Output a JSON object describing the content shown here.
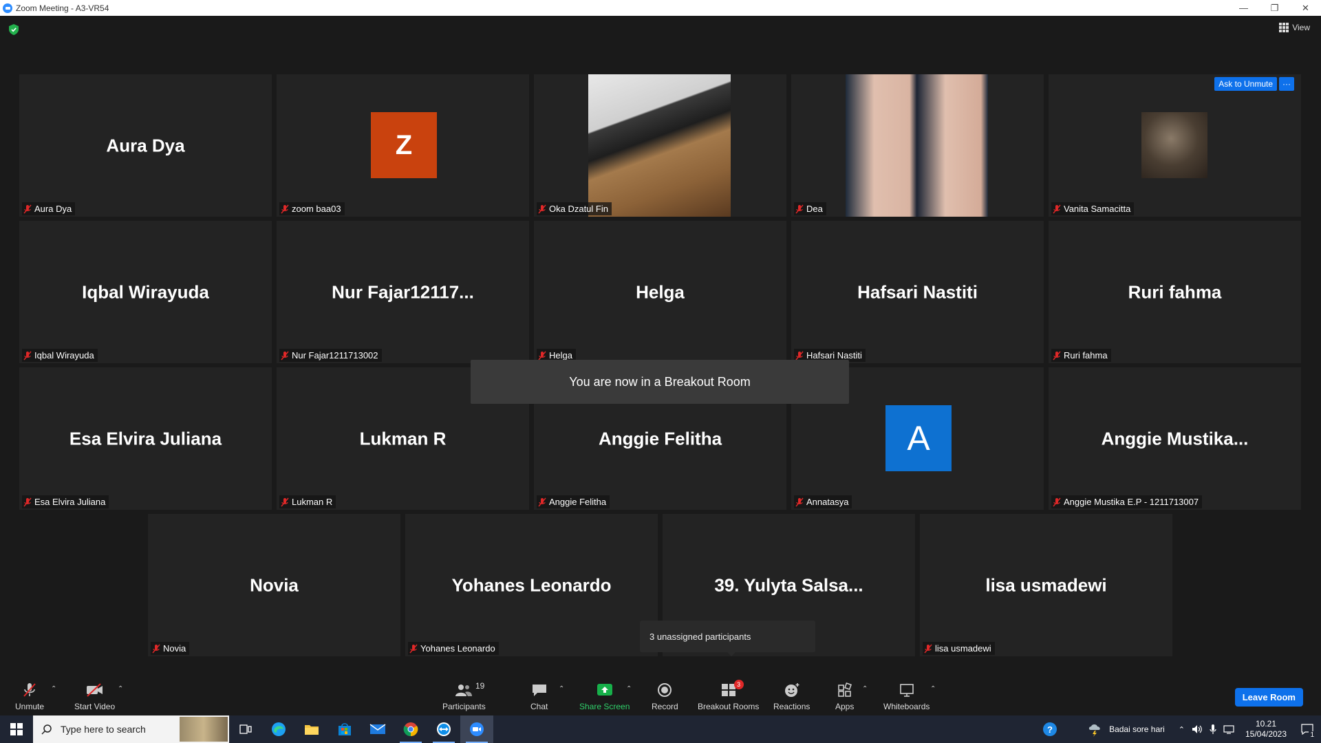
{
  "window": {
    "title": "Zoom Meeting - A3-VR54"
  },
  "meeting": {
    "view_label": "View",
    "ask_unmute_label": "Ask to Unmute",
    "more_label": "···",
    "toast": "You are now in a Breakout Room",
    "tooltip": "3 unassigned participants"
  },
  "tiles": [
    {
      "big": "Aura Dya",
      "label": "Aura Dya"
    },
    {
      "big": "Z",
      "label": "zoom baa03"
    },
    {
      "big": "",
      "label": "Oka Dzatul Fin"
    },
    {
      "big": "",
      "label": "Dea"
    },
    {
      "big": "",
      "label": "Vanita Samacitta"
    },
    {
      "big": "Iqbal Wirayuda",
      "label": "Iqbal Wirayuda"
    },
    {
      "big": "Nur  Fajar12117...",
      "label": "Nur Fajar1211713002"
    },
    {
      "big": "Helga",
      "label": "Helga"
    },
    {
      "big": "Hafsari Nastiti",
      "label": "Hafsari Nastiti"
    },
    {
      "big": "Ruri fahma",
      "label": "Ruri fahma"
    },
    {
      "big": "Esa Elvira Juliana",
      "label": "Esa Elvira Juliana"
    },
    {
      "big": "Lukman R",
      "label": "Lukman R"
    },
    {
      "big": "Anggie Felitha",
      "label": "Anggie Felitha"
    },
    {
      "big": "A",
      "label": "Annatasya"
    },
    {
      "big": "Anggie  Mustika...",
      "label": "Anggie Mustika E.P - 1211713007"
    },
    {
      "big": "Novia",
      "label": "Novia"
    },
    {
      "big": "Yohanes Leonardo",
      "label": "Yohanes Leonardo"
    },
    {
      "big": "39.  Yulyta  Salsa...",
      "label": ""
    },
    {
      "big": "lisa usmadewi",
      "label": "lisa usmadewi"
    }
  ],
  "toolbar": {
    "unmute": "Unmute",
    "start_video": "Start Video",
    "participants": "Participants",
    "participants_count": "19",
    "chat": "Chat",
    "share_screen": "Share Screen",
    "record": "Record",
    "breakout_rooms": "Breakout Rooms",
    "breakout_badge": "3",
    "reactions": "Reactions",
    "apps": "Apps",
    "whiteboards": "Whiteboards",
    "leave": "Leave Room"
  },
  "taskbar": {
    "search_placeholder": "Type here to search",
    "weather": "Badai sore hari",
    "time": "10.21",
    "date": "15/04/2023",
    "notification_count": "1"
  },
  "colors": {
    "accent": "#0e71eb",
    "share_green": "#17b04a",
    "muted_red": "#e02828",
    "avatar_z": "#c9420e",
    "avatar_a": "#0e71d1"
  }
}
